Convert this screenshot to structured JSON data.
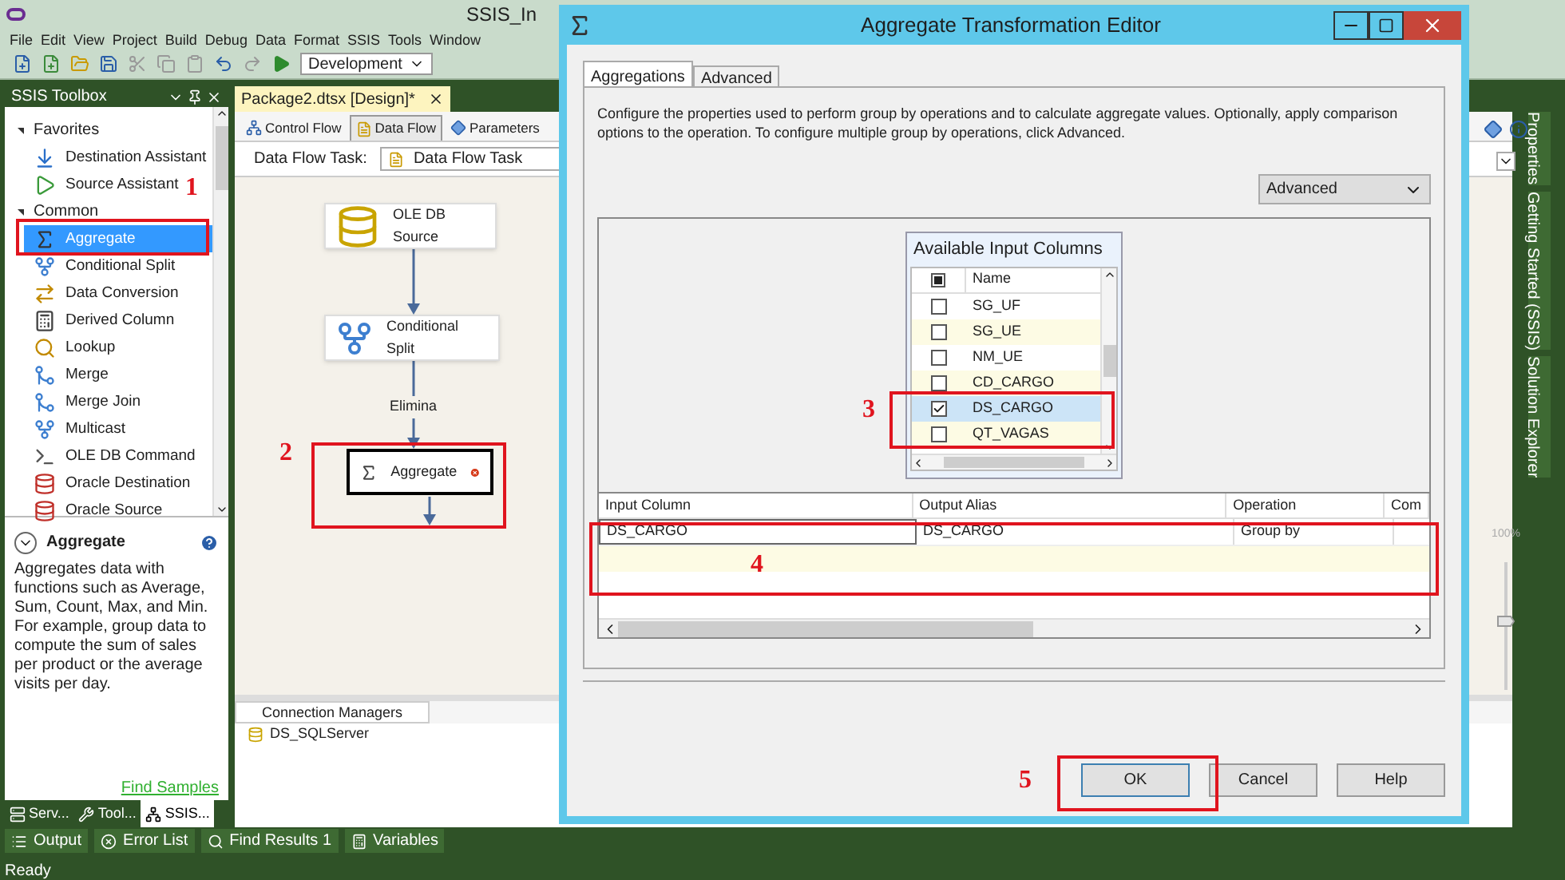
{
  "window": {
    "title": "SSIS_In"
  },
  "menu": [
    "File",
    "Edit",
    "View",
    "Project",
    "Build",
    "Debug",
    "Data",
    "Format",
    "SSIS",
    "Tools",
    "Window"
  ],
  "toolbar": {
    "configuration": "Development"
  },
  "toolbox": {
    "title": "SSIS Toolbox",
    "groups": [
      {
        "label": "Favorites",
        "expanded": true,
        "items": [
          {
            "label": "Destination Assistant",
            "kind": "dest",
            "selected": false
          },
          {
            "label": "Source Assistant",
            "kind": "src",
            "selected": false
          }
        ]
      },
      {
        "label": "Common",
        "expanded": true,
        "items": [
          {
            "label": "Aggregate",
            "kind": "sigma",
            "selected": true
          },
          {
            "label": "Conditional Split",
            "kind": "split",
            "selected": false
          },
          {
            "label": "Data Conversion",
            "kind": "convert",
            "selected": false
          },
          {
            "label": "Derived Column",
            "kind": "derived",
            "selected": false
          },
          {
            "label": "Lookup",
            "kind": "lookup",
            "selected": false
          },
          {
            "label": "Merge",
            "kind": "merge",
            "selected": false
          },
          {
            "label": "Merge Join",
            "kind": "merge",
            "selected": false
          },
          {
            "label": "Multicast",
            "kind": "split",
            "selected": false
          },
          {
            "label": "OLE DB Command",
            "kind": "command",
            "selected": false
          },
          {
            "label": "Oracle Destination",
            "kind": "oracle",
            "selected": false
          },
          {
            "label": "Oracle Source",
            "kind": "oracle",
            "selected": false
          }
        ]
      }
    ]
  },
  "description": {
    "title": "Aggregate",
    "text": "Aggregates data with functions such as Average, Sum, Count, Max, and Min. For example, group data to compute the sum of sales per product or the average visits per day.",
    "link": "Find Samples"
  },
  "toolbox_tabs": [
    {
      "label": "Serv...",
      "selected": false
    },
    {
      "label": "Tool...",
      "selected": false
    },
    {
      "label": "SSIS...",
      "selected": true
    }
  ],
  "document": {
    "tab": "Package2.dtsx [Design]*",
    "designer_tabs": [
      {
        "label": "Control Flow",
        "selected": false
      },
      {
        "label": "Data Flow",
        "selected": true
      },
      {
        "label": "Parameters",
        "selected": false
      }
    ],
    "task_label": "Data Flow Task:",
    "task_value": "Data Flow Task",
    "nodes": [
      {
        "label": "OLE DB Source",
        "kind": "source",
        "selected": false,
        "error": false
      },
      {
        "label": "Conditional Split",
        "kind": "split",
        "selected": false,
        "error": false
      },
      {
        "label": "Aggregate",
        "kind": "sigma",
        "selected": true,
        "error": true
      }
    ],
    "path_label": "Elimina",
    "zoom_label": "100%",
    "zoom": {
      "level": 0.5
    },
    "connection_managers": {
      "title": "Connection Managers",
      "items": [
        "DS_SQLServer"
      ]
    }
  },
  "side_tabs": [
    "Properties",
    "Getting Started (SSIS)",
    "Solution Explorer"
  ],
  "bottom_tabs": [
    "Output",
    "Error List",
    "Find Results 1",
    "Variables"
  ],
  "status_bar": "Ready",
  "dialog": {
    "title": "Aggregate Transformation Editor",
    "tabs": [
      {
        "label": "Aggregations",
        "selected": true
      },
      {
        "label": "Advanced",
        "selected": false
      }
    ],
    "description": "Configure the properties used to perform group by operations and to calculate aggregate values. Optionally, apply comparison options to the operation. To configure multiple group by operations, click Advanced.",
    "advanced_button": "Advanced",
    "columns_list": {
      "title": "Available Input Columns",
      "header": "Name",
      "header_partial": true,
      "rows": [
        {
          "name": "SG_UF",
          "checked": false,
          "selected": false
        },
        {
          "name": "SG_UE",
          "checked": false,
          "selected": false
        },
        {
          "name": "NM_UE",
          "checked": false,
          "selected": false
        },
        {
          "name": "CD_CARGO",
          "checked": false,
          "selected": false
        },
        {
          "name": "DS_CARGO",
          "checked": true,
          "selected": true
        },
        {
          "name": "QT_VAGAS",
          "checked": false,
          "selected": false
        }
      ]
    },
    "grid": {
      "columns": [
        "Input Column",
        "Output Alias",
        "Operation",
        "Com"
      ],
      "rows": [
        [
          "DS_CARGO",
          "DS_CARGO",
          "Group by"
        ]
      ]
    },
    "buttons": [
      "OK",
      "Cancel",
      "Help"
    ]
  },
  "annotations": [
    "1",
    "2",
    "3",
    "4",
    "5"
  ]
}
